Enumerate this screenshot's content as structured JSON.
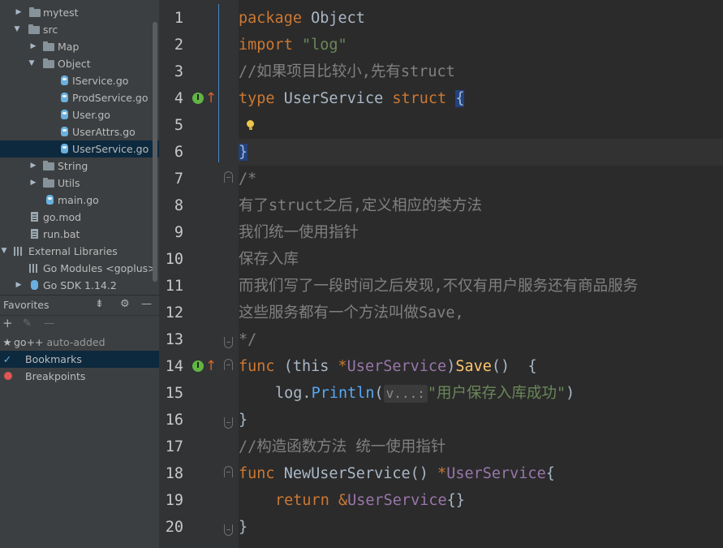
{
  "project_tree": {
    "items": [
      {
        "label": "mytest",
        "indent": 2,
        "expanded": false,
        "icon": "folder-icon"
      },
      {
        "label": "src",
        "indent": 1,
        "expanded": true,
        "icon": "folder-icon"
      },
      {
        "label": "Map",
        "indent": 2,
        "expanded": false,
        "icon": "folder-icon"
      },
      {
        "label": "Object",
        "indent": 2,
        "expanded": true,
        "icon": "folder-icon"
      },
      {
        "label": "IService.go",
        "indent": 3,
        "icon": "go-file-icon"
      },
      {
        "label": "ProdService.go",
        "indent": 3,
        "icon": "go-file-icon"
      },
      {
        "label": "User.go",
        "indent": 3,
        "icon": "go-file-icon"
      },
      {
        "label": "UserAttrs.go",
        "indent": 3,
        "icon": "go-file-icon"
      },
      {
        "label": "UserService.go",
        "indent": 3,
        "icon": "go-file-icon",
        "selected": true
      },
      {
        "label": "String",
        "indent": 2,
        "expanded": false,
        "icon": "folder-icon"
      },
      {
        "label": "Utils",
        "indent": 2,
        "expanded": false,
        "icon": "folder-icon"
      },
      {
        "label": "main.go",
        "indent": 2,
        "icon": "go-file-icon"
      },
      {
        "label": "go.mod",
        "indent": 1,
        "icon": "doc-icon"
      },
      {
        "label": "run.bat",
        "indent": 1,
        "icon": "doc-icon"
      },
      {
        "label": "External Libraries",
        "indent": 0,
        "expanded": true,
        "icon": "library-icon"
      },
      {
        "label": "Go Modules <goplus>",
        "indent": 1,
        "icon": "library-icon"
      },
      {
        "label": "Go SDK 1.14.2",
        "indent": 1,
        "expanded": false,
        "icon": "sdk-icon"
      }
    ]
  },
  "favorites": {
    "title": "Favorites",
    "items": [
      {
        "label": "go++",
        "sub": "auto-added",
        "icon": "star-icon"
      },
      {
        "label": "Bookmarks",
        "icon": "check-icon",
        "selected": true
      },
      {
        "label": "Breakpoints",
        "icon": "breakpoint-icon"
      }
    ]
  },
  "editor": {
    "line_numbers": [
      "1",
      "2",
      "3",
      "4",
      "5",
      "6",
      "7",
      "8",
      "9",
      "10",
      "11",
      "12",
      "13",
      "14",
      "15",
      "16",
      "17",
      "18",
      "19",
      "20"
    ],
    "code": {
      "l1_kw": "package",
      "l1_rest": " Object",
      "l2_kw": "import",
      "l2_str": " \"log\"",
      "l3": "//如果项目比较小,先有struct",
      "l4_kw1": "type",
      "l4_name": " UserService ",
      "l4_kw2": "struct",
      "l4_brace": "{",
      "l6": "}",
      "l7": "/*",
      "l8": "有了struct之后,定义相应的类方法",
      "l9": "我们统一使用指针",
      "l10": "保存入库",
      "l11": "而我们写了一段时间之后发现,不仅有用户服务还有商品服务",
      "l12": "这些服务都有一个方法叫做Save,",
      "l13": "*/",
      "l14_kw": "func",
      "l14_a": " (this ",
      "l14_ptr": "*",
      "l14_type": "UserService",
      "l14_b": ")",
      "l14_fn": "Save",
      "l14_c": "()  {",
      "l15_a": "log.",
      "l15_call": "Println",
      "l15_b": "(",
      "l15_hint": "v...:",
      "l15_str": "\"用户保存入库成功\"",
      "l15_c": ")",
      "l16": "}",
      "l17": "//构造函数方法 统一使用指针",
      "l18_kw": "func",
      "l18_a": " NewUserService() ",
      "l18_ptr": "*",
      "l18_type": "UserService",
      "l18_b": "{",
      "l19_kw": "return",
      "l19_amp": " &",
      "l19_type": "UserService",
      "l19_b": "{}",
      "l20": "}"
    }
  },
  "colors": {
    "editor_bg": "#2b2b2b",
    "panel_bg": "#3c3f41",
    "keyword": "#cc7832",
    "string": "#6a8759",
    "comment": "#808080",
    "function": "#ffc66d",
    "selection": "#0d293e"
  }
}
